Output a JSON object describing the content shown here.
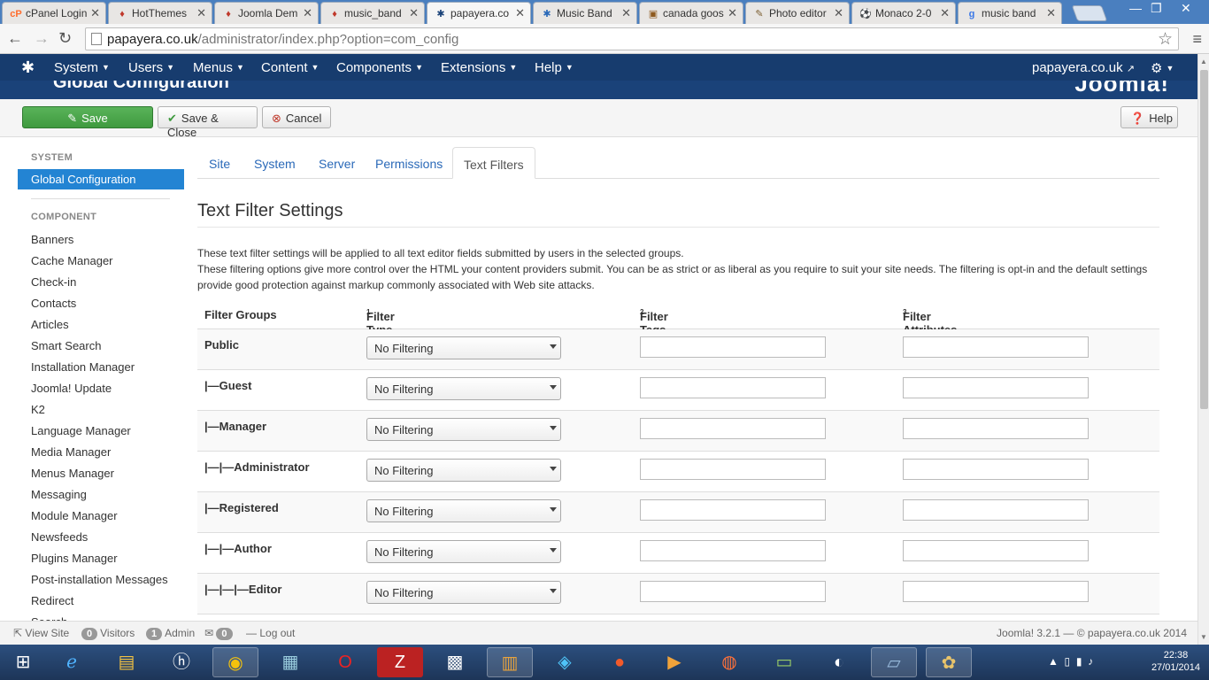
{
  "browser": {
    "tabs": [
      {
        "label": "cPanel Login",
        "icon": "cpanel-icon",
        "glyph": "cP",
        "color": "#ff6c2c"
      },
      {
        "label": "HotThemes",
        "icon": "hotthemes-icon",
        "glyph": "♦",
        "color": "#c0392b"
      },
      {
        "label": "Joomla Dem",
        "icon": "joomla-demo-icon",
        "glyph": "♦",
        "color": "#c0392b"
      },
      {
        "label": "music_band",
        "icon": "music-band-icon",
        "glyph": "♦",
        "color": "#c0392b"
      },
      {
        "label": "papayera.co",
        "icon": "joomla-icon",
        "glyph": "✱",
        "color": "#1a4279",
        "active": true
      },
      {
        "label": "Music Band",
        "icon": "joomla-icon",
        "glyph": "✱",
        "color": "#2a69b8"
      },
      {
        "label": "canada goos",
        "icon": "shopping-icon",
        "glyph": "▣",
        "color": "#8e5a1f"
      },
      {
        "label": "Photo editor",
        "icon": "brush-icon",
        "glyph": "✎",
        "color": "#7a5c2e"
      },
      {
        "label": "Monaco 2-0",
        "icon": "football-icon",
        "glyph": "⚽",
        "color": "#222"
      },
      {
        "label": "music band",
        "icon": "google-icon",
        "glyph": "g",
        "color": "#3b78e7"
      }
    ],
    "url": "papayera.co.uk/administrator/index.php?option=com_config",
    "url_host": "papayera.co.uk",
    "url_path": "/administrator/index.php?option=com_config"
  },
  "jnav": {
    "items": [
      "System",
      "Users",
      "Menus",
      "Content",
      "Components",
      "Extensions",
      "Help"
    ],
    "site_link": "papayera.co.uk",
    "title": "Global Configuration",
    "brand": "Joomla!"
  },
  "actions": {
    "save": "Save",
    "save_close": "Save & Close",
    "cancel": "Cancel",
    "help": "Help"
  },
  "sidebar": {
    "system_heading": "SYSTEM",
    "active_item": "Global Configuration",
    "component_heading": "COMPONENT",
    "items": [
      "Banners",
      "Cache Manager",
      "Check-in",
      "Contacts",
      "Articles",
      "Smart Search",
      "Installation Manager",
      "Joomla! Update",
      "K2",
      "Language Manager",
      "Media Manager",
      "Menus Manager",
      "Messaging",
      "Module Manager",
      "Newsfeeds",
      "Plugins Manager",
      "Post-installation Messages",
      "Redirect",
      "Search"
    ]
  },
  "main": {
    "tabs": [
      "Site",
      "System",
      "Server",
      "Permissions",
      "Text Filters"
    ],
    "heading": "Text Filter Settings",
    "desc_line1": "These text filter settings will be applied to all text editor fields submitted by users in the selected groups.",
    "desc_line2": "These filtering options give more control over the HTML your content providers submit. You can be as strict or as liberal as you require to suit your site needs. The filtering is opt-in and the default settings provide good protection against markup commonly associated with Web site attacks.",
    "columns": {
      "groups": "Filter Groups",
      "type": "Filter Type",
      "type_sup": "1",
      "tags": "Filter Tags",
      "tags_sup": "2",
      "attrs": "Filter Attributes",
      "attrs_sup": "3"
    },
    "rows": [
      {
        "group": "Public",
        "filter": "No Filtering"
      },
      {
        "group": "|—Guest",
        "filter": "No Filtering"
      },
      {
        "group": "|—Manager",
        "filter": "No Filtering"
      },
      {
        "group": "|—|—Administrator",
        "filter": "No Filtering"
      },
      {
        "group": "|—Registered",
        "filter": "No Filtering"
      },
      {
        "group": "|—|—Author",
        "filter": "No Filtering"
      },
      {
        "group": "|—|—|—Editor",
        "filter": "No Filtering"
      }
    ]
  },
  "status": {
    "view_site": "View Site",
    "visitors_count": "0",
    "visitors": "Visitors",
    "admin_count": "1",
    "admin": "Admin",
    "messages_count": "0",
    "logout": "Log out",
    "footer": "Joomla! 3.2.1 — © papayera.co.uk 2014"
  },
  "taskbar": {
    "time": "22:38",
    "date": "27/01/2014"
  }
}
